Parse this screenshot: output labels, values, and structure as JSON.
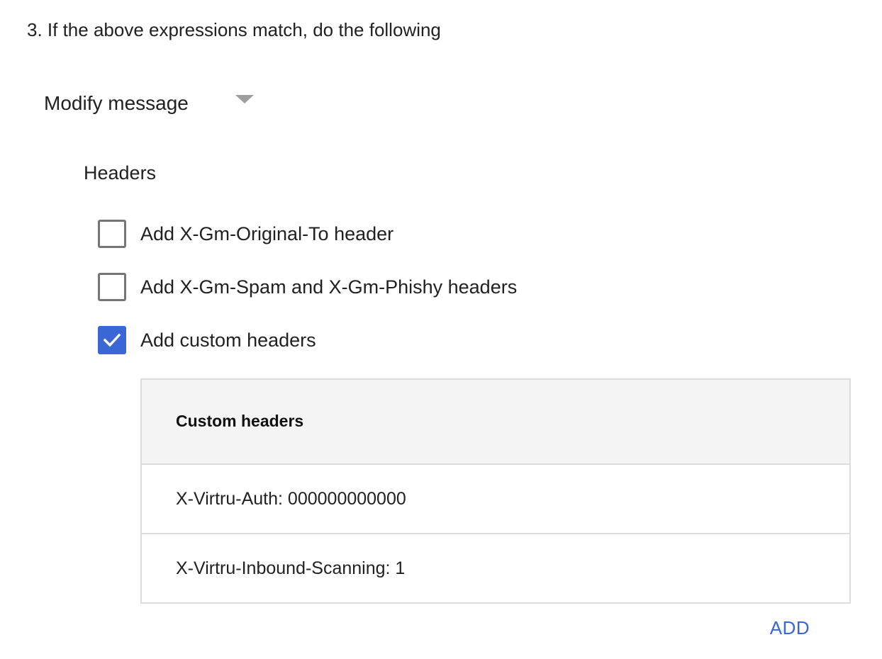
{
  "step": {
    "title": "3. If the above expressions match, do the following"
  },
  "action": {
    "selected": "Modify message",
    "icon": "dropdown-caret-icon"
  },
  "headers_section": {
    "label": "Headers",
    "options": [
      {
        "label": "Add X-Gm-Original-To header",
        "checked": false
      },
      {
        "label": "Add X-Gm-Spam and X-Gm-Phishy headers",
        "checked": false
      },
      {
        "label": "Add custom headers",
        "checked": true
      }
    ]
  },
  "custom_headers": {
    "column_header": "Custom headers",
    "rows": [
      "X-Virtru-Auth: 000000000000",
      "X-Virtru-Inbound-Scanning: 1"
    ],
    "add_label": "ADD"
  },
  "colors": {
    "accent": "#3b66d6",
    "checkbox_border": "#757575",
    "table_header_bg": "#f4f4f4",
    "table_border": "#dcdcdc",
    "caret": "#9e9e9e"
  }
}
